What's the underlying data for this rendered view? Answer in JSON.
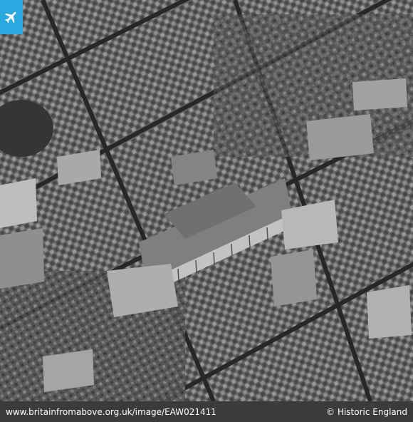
{
  "photo": {
    "subject": "aerial-photograph-city-blocks",
    "style": "black-and-white",
    "badge_icon": "airplane-icon",
    "badge_color": "#2aa8e0"
  },
  "footer": {
    "url_text": "www.britainfromabove.org.uk/image/EAW021411",
    "copyright_symbol": "©",
    "credit": "Historic England",
    "background": "#3b3b3b"
  }
}
